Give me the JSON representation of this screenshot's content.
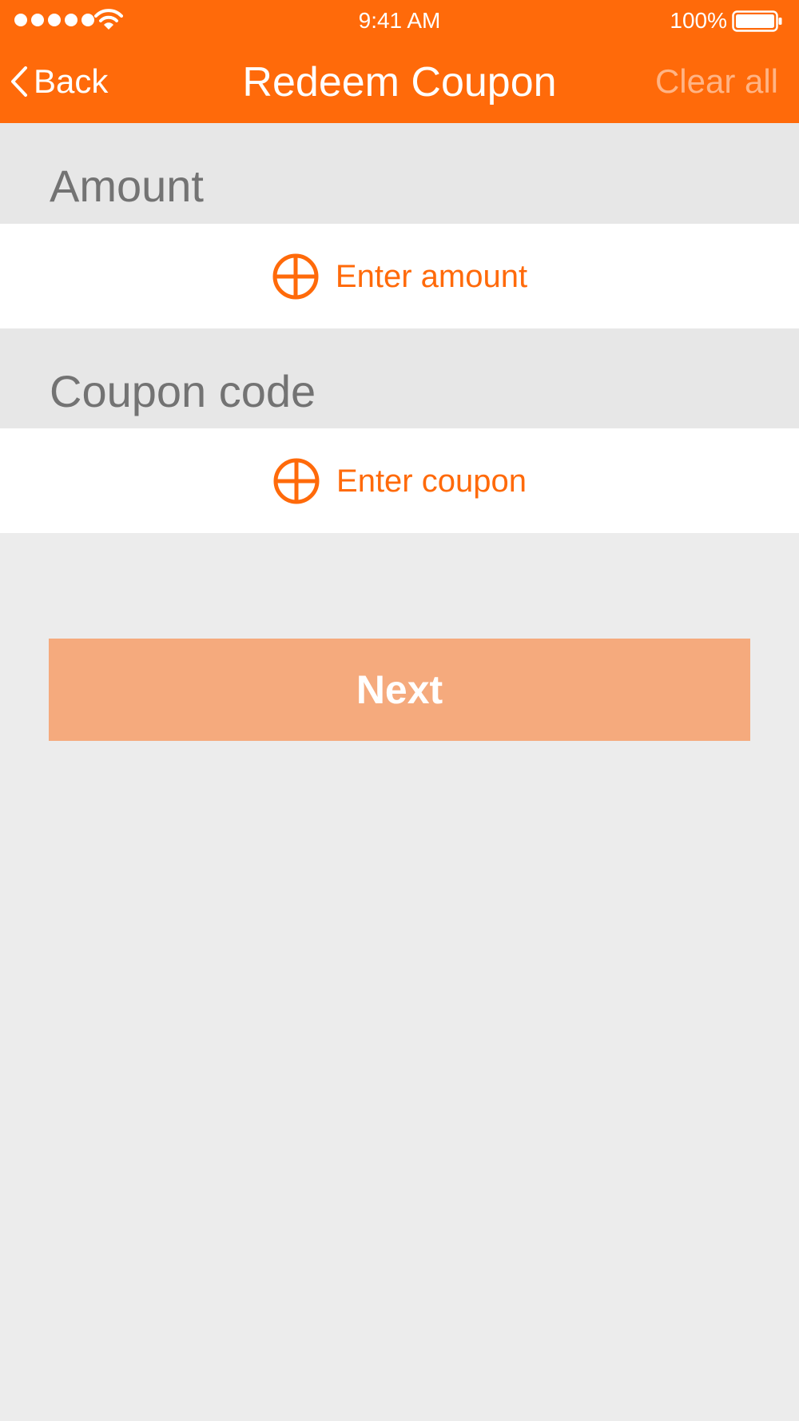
{
  "status_bar": {
    "signal_icon": "signal-dots-icon",
    "wifi_icon": "wifi-icon",
    "time": "9:41 AM",
    "battery_percent": "100%",
    "battery_icon": "battery-full-icon"
  },
  "nav": {
    "back_label": "Back",
    "title": "Redeem Coupon",
    "clear_all_label": "Clear all"
  },
  "sections": {
    "amount": {
      "header": "Amount",
      "action_label": "Enter amount",
      "action_icon": "plus-circle-icon"
    },
    "coupon": {
      "header": "Coupon code",
      "action_label": "Enter coupon",
      "action_icon": "plus-circle-icon"
    }
  },
  "next_button_label": "Next",
  "colors": {
    "accent": "#ff6a0a",
    "next_button": "#f5aa7d",
    "clear_all_text": "#ffb485",
    "section_header_bg": "#e7e7e7",
    "background": "#ececec"
  }
}
